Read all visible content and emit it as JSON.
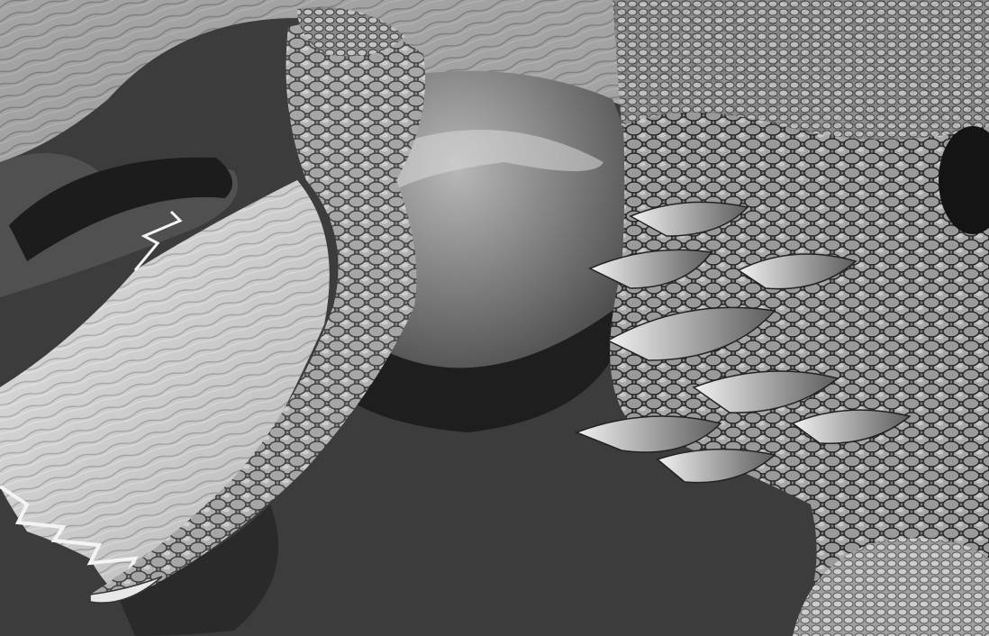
{
  "viewport": {
    "background_color": "#3c3c3c",
    "material_light": "#e8e8e8",
    "material_mid": "#8e8e8e",
    "material_dark": "#1e1e1e",
    "description_icons": [
      "dragon-wing-membrane",
      "dragon-foreleg-claw",
      "dragon-belly-scales",
      "dragon-dorsal-spikes",
      "dragon-head-left",
      "dragon-tail-right"
    ]
  }
}
